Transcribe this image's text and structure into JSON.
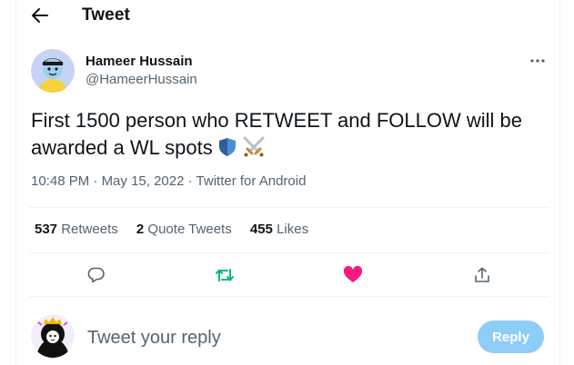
{
  "header": {
    "title": "Tweet"
  },
  "tweet": {
    "author_name": "Hameer Hussain",
    "author_handle": "@HameerHussain",
    "text": "First 1500 person who RETWEET and FOLLOW will be awarded a WL spots",
    "emojis": [
      "shield-icon",
      "crossed-swords-icon"
    ],
    "time": "10:48 PM",
    "dot1": " · ",
    "date": "May 15, 2022",
    "dot2": " · ",
    "source": "Twitter for Android"
  },
  "stats": {
    "retweets_count": "537",
    "retweets_label": "Retweets",
    "quotes_count": "2",
    "quotes_label": "Quote Tweets",
    "likes_count": "455",
    "likes_label": "Likes"
  },
  "actions": {
    "icons": [
      "reply-icon",
      "retweet-icon",
      "like-icon",
      "share-icon"
    ],
    "colors": {
      "retweet": "#00ba7c",
      "like": "#f91880",
      "default": "#536471"
    }
  },
  "reply": {
    "placeholder": "Tweet your reply",
    "button_label": "Reply",
    "button_color": "#8ecdf8"
  }
}
